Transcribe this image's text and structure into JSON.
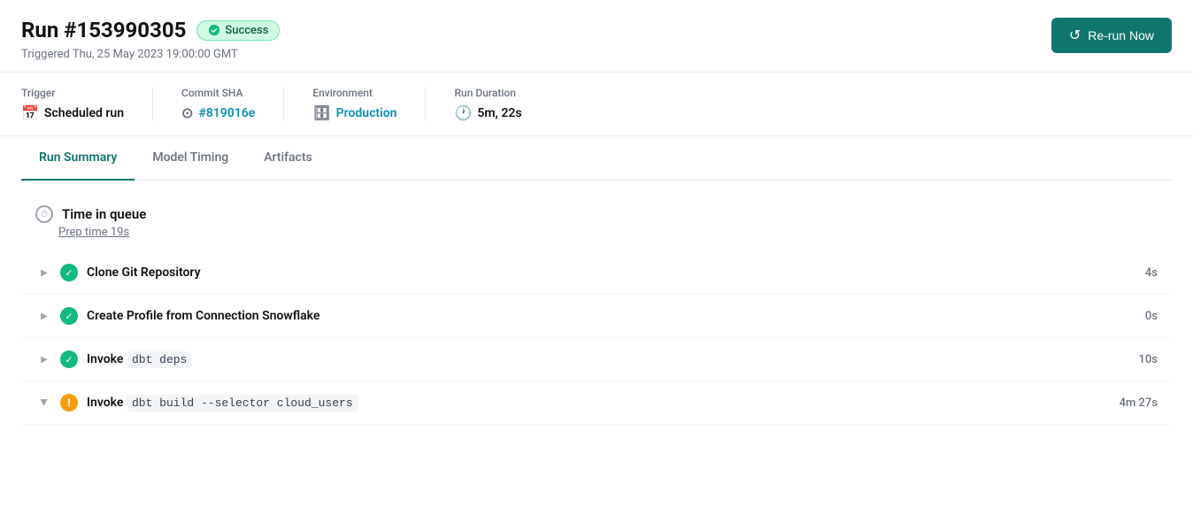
{
  "header": {
    "title": "Run #153990305",
    "status": "Success",
    "triggered": "Triggered Thu, 25 May 2023 19:00:00 GMT",
    "rerun_button": "Re-run Now"
  },
  "meta": {
    "trigger": {
      "label": "Trigger",
      "value": "Scheduled run"
    },
    "commit": {
      "label": "Commit SHA",
      "value": "#819016e",
      "href": "#"
    },
    "environment": {
      "label": "Environment",
      "value": "Production",
      "href": "#"
    },
    "duration": {
      "label": "Run Duration",
      "value": "5m, 22s"
    }
  },
  "tabs": [
    {
      "label": "Run Summary",
      "active": true
    },
    {
      "label": "Model Timing",
      "active": false
    },
    {
      "label": "Artifacts",
      "active": false
    }
  ],
  "queue": {
    "title": "Time in queue",
    "sub_label": "Prep time 19s"
  },
  "steps": [
    {
      "name": "Clone Git Repository",
      "name_plain": "Clone Git Repository",
      "status": "success",
      "duration": "4s"
    },
    {
      "name": "Create Profile from Connection Snowflake",
      "name_plain": "Create Profile from Connection Snowflake",
      "status": "success",
      "duration": "0s"
    },
    {
      "name_prefix": "Invoke",
      "name_code": "dbt deps",
      "status": "success",
      "duration": "10s"
    },
    {
      "name_prefix": "Invoke",
      "name_code": "dbt build --selector cloud_users",
      "status": "warning",
      "duration": "4m 27s"
    }
  ]
}
